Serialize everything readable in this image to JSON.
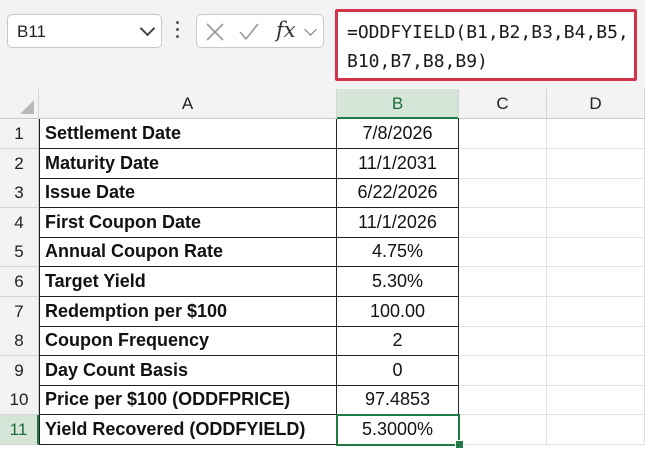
{
  "name_box": {
    "value": "B11"
  },
  "formula_bar": {
    "formula": "=ODDFYIELD(B1,B2,B3,B4,B5,B10,B7,B8,B9)",
    "fx_label": "fx",
    "cancel_icon": "x-icon",
    "enter_icon": "check-icon"
  },
  "columns": [
    "A",
    "B",
    "C",
    "D"
  ],
  "selected_column": "B",
  "selected_row": "11",
  "rows": [
    {
      "num": "1",
      "label": "Settlement Date",
      "value": "7/8/2026"
    },
    {
      "num": "2",
      "label": "Maturity Date",
      "value": "11/1/2031"
    },
    {
      "num": "3",
      "label": "Issue Date",
      "value": "6/22/2026"
    },
    {
      "num": "4",
      "label": "First Coupon Date",
      "value": "11/1/2026"
    },
    {
      "num": "5",
      "label": "Annual Coupon Rate",
      "value": "4.75%"
    },
    {
      "num": "6",
      "label": "Target Yield",
      "value": "5.30%"
    },
    {
      "num": "7",
      "label": "Redemption per $100",
      "value": "100.00"
    },
    {
      "num": "8",
      "label": "Coupon Frequency",
      "value": "2"
    },
    {
      "num": "9",
      "label": "Day Count Basis",
      "value": "0"
    },
    {
      "num": "10",
      "label": "Price per $100 (ODDFPRICE)",
      "value": "97.4853"
    },
    {
      "num": "11",
      "label": "Yield Recovered (ODDFYIELD)",
      "value": "5.3000%"
    }
  ],
  "colors": {
    "accent": "#1f7a43",
    "formula_highlight": "#d2334a",
    "header_bg": "#f3f3f3",
    "selected_header_bg": "#d5e6d8"
  }
}
